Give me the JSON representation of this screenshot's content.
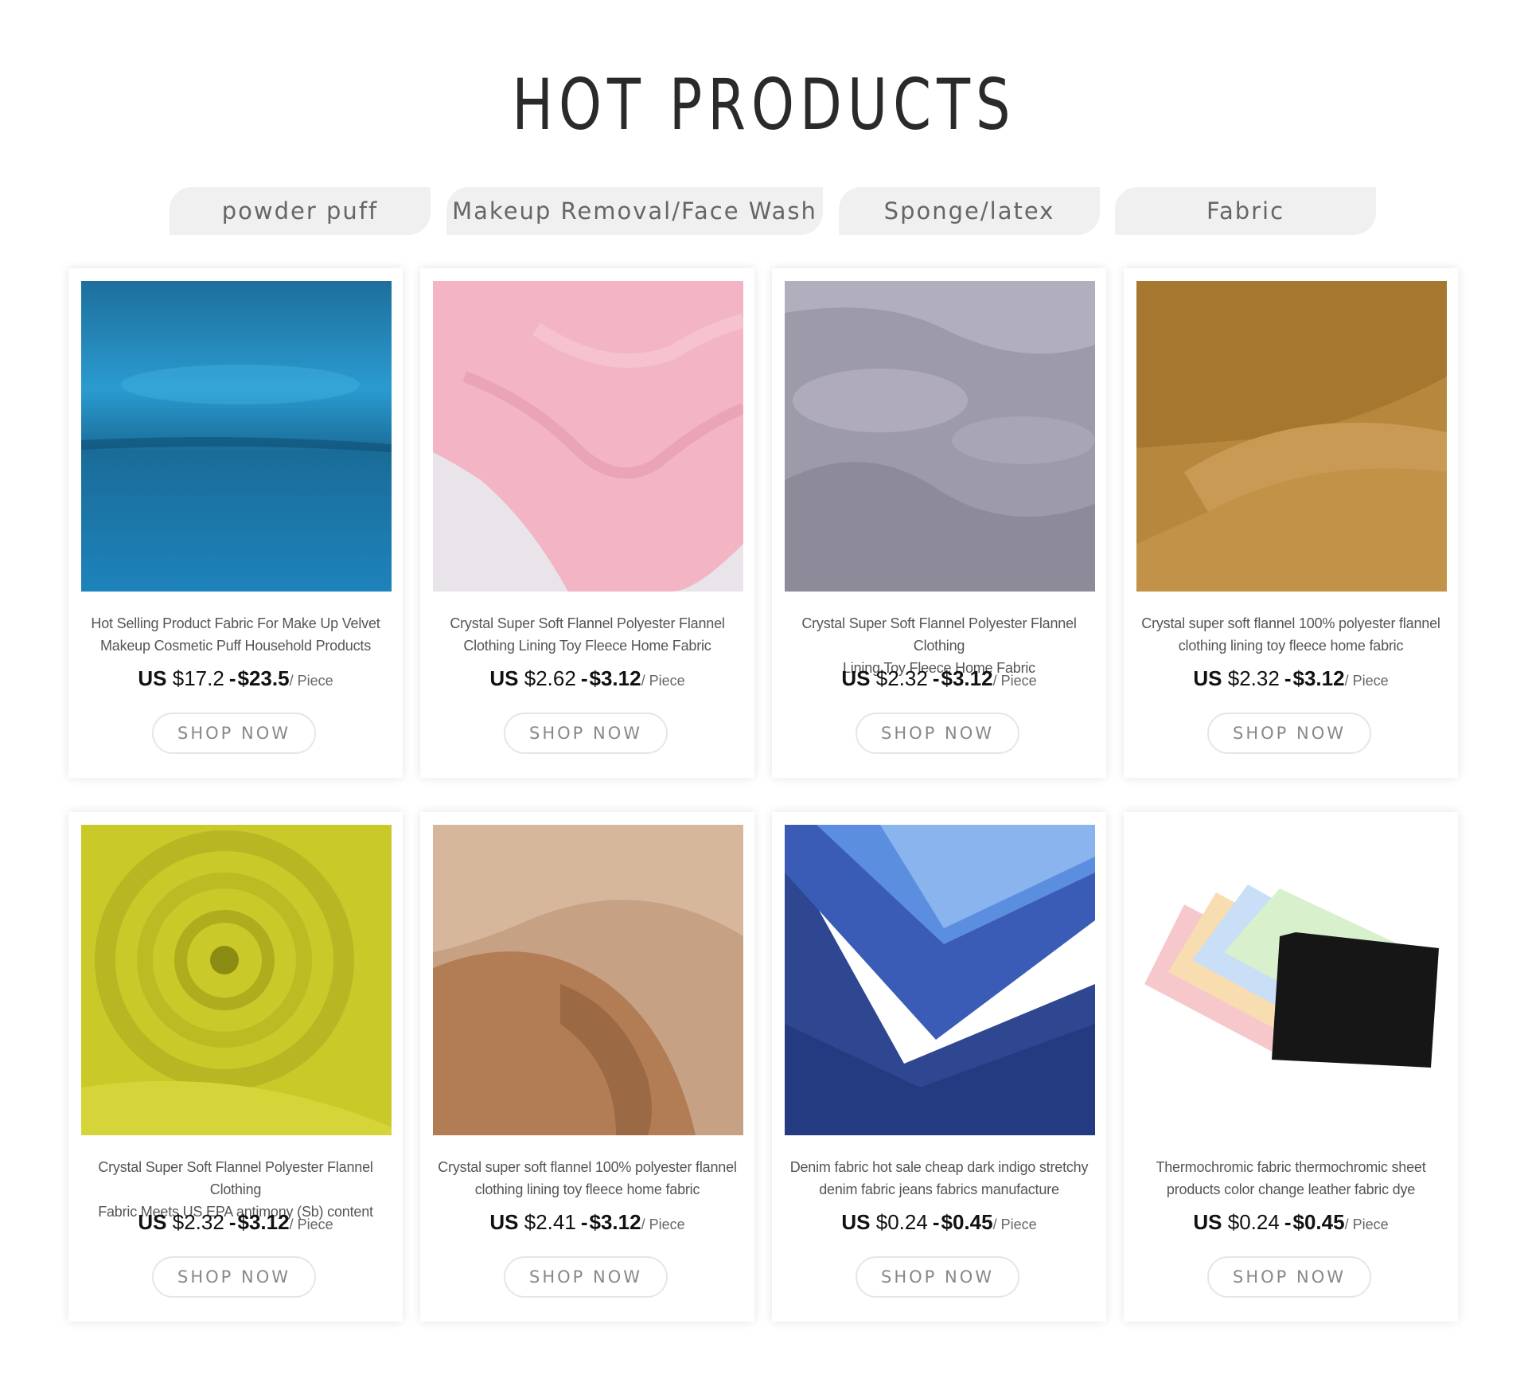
{
  "section": {
    "title": "HOT PRODUCTS"
  },
  "tabs": [
    "powder puff",
    "Makeup Removal/Face Wash",
    "Sponge/latex",
    "Fabric"
  ],
  "shop_label": "SHOP NOW",
  "products": [
    {
      "title_l1": "Hot Selling Product Fabric For Make Up Velvet",
      "title_l2": "Makeup Cosmetic Puff Household Products",
      "currency": "US",
      "price_low": "$17.2",
      "price_sep": "-",
      "price_high": "$23.5",
      "unit": "/ Piece",
      "image_icon": "blue-velvet-fabric-image"
    },
    {
      "title_l1": "Crystal Super Soft Flannel Polyester Flannel",
      "title_l2": "Clothing Lining Toy Fleece Home Fabric",
      "currency": "US",
      "price_low": "$2.62",
      "price_sep": "-",
      "price_high": "$3.12",
      "unit": "/ Piece",
      "image_icon": "pink-flannel-fabric-image"
    },
    {
      "title_l1": "Crystal Super Soft Flannel Polyester Flannel Clothing",
      "title_l2": "Lining Toy Fleece Home Fabric",
      "currency": "US",
      "price_low": "$2.32",
      "price_sep": "-",
      "price_high": "$3.12",
      "unit": "/ Piece",
      "image_icon": "lavender-flannel-fabric-image"
    },
    {
      "title_l1": "Crystal super soft flannel 100% polyester flannel",
      "title_l2": "clothing lining toy fleece home fabric",
      "currency": "US",
      "price_low": "$2.32",
      "price_sep": "-",
      "price_high": "$3.12",
      "unit": "/ Piece",
      "image_icon": "tan-flannel-fabric-image"
    },
    {
      "title_l1": "Crystal Super Soft Flannel Polyester Flannel Clothing",
      "title_l2": "Fabric Meets US EPA antimony (Sb) content",
      "currency": "US",
      "price_low": "$2.32",
      "price_sep": "-",
      "price_high": "$3.12",
      "unit": "/ Piece",
      "image_icon": "yellow-swirl-fabric-image"
    },
    {
      "title_l1": "Crystal super soft flannel 100% polyester flannel",
      "title_l2": "clothing lining toy fleece home fabric",
      "currency": "US",
      "price_low": "$2.41",
      "price_sep": "-",
      "price_high": "$3.12",
      "unit": "/ Piece",
      "image_icon": "plush-fleece-fabric-image"
    },
    {
      "title_l1": "Denim fabric hot sale cheap dark indigo stretchy",
      "title_l2": "denim fabric jeans fabrics manufacture",
      "currency": "US",
      "price_low": "$0.24",
      "price_sep": "-",
      "price_high": "$0.45",
      "unit": "/ Piece",
      "image_icon": "denim-fabric-image"
    },
    {
      "title_l1": "Thermochromic fabric thermochromic sheet",
      "title_l2": "products color change leather fabric dye",
      "currency": "US",
      "price_low": "$0.24",
      "price_sep": "-",
      "price_high": "$0.45",
      "unit": "/ Piece",
      "image_icon": "cleaning-cloth-swatches-image"
    }
  ]
}
